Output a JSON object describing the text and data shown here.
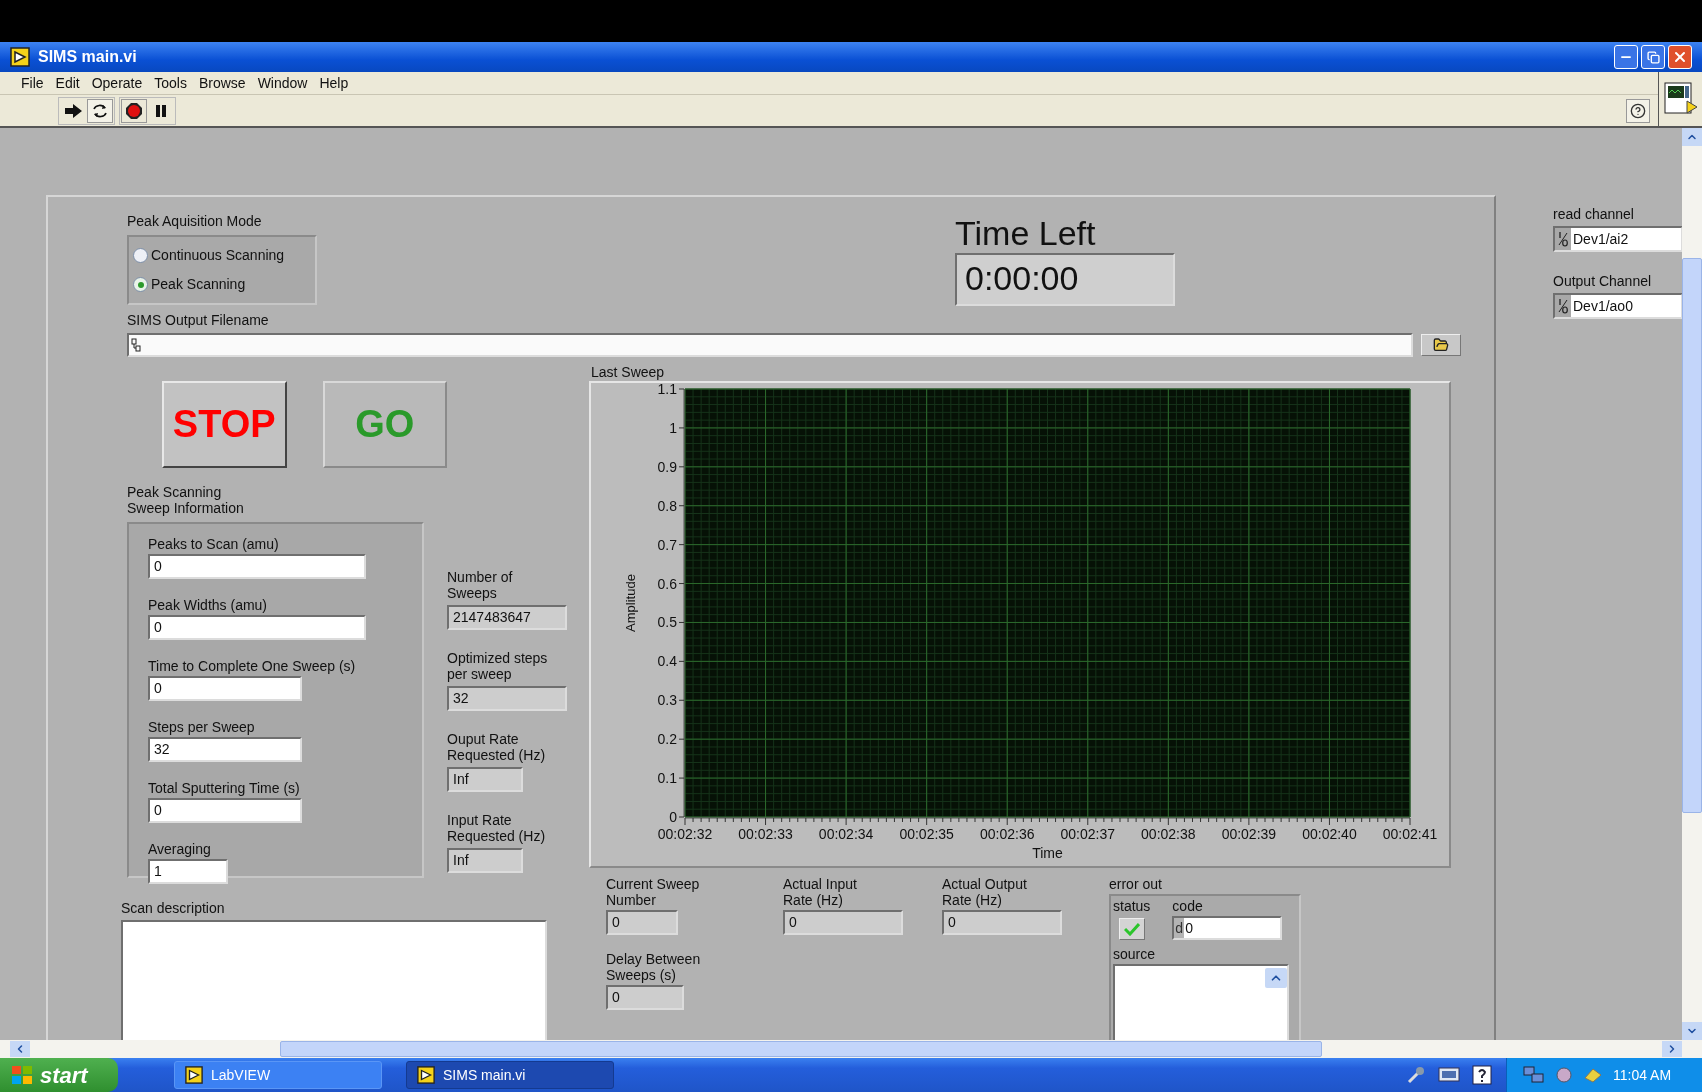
{
  "window": {
    "title": "SIMS main.vi",
    "menu": [
      "File",
      "Edit",
      "Operate",
      "Tools",
      "Browse",
      "Window",
      "Help"
    ]
  },
  "acquisition_mode": {
    "label": "Peak Aquisition Mode",
    "options": [
      {
        "label": "Continuous Scanning",
        "selected": false
      },
      {
        "label": "Peak Scanning",
        "selected": true
      }
    ]
  },
  "time_left": {
    "label": "Time Left",
    "value": "0:00:00"
  },
  "output_filename": {
    "label": "SIMS Output Filename"
  },
  "buttons": [
    {
      "label": "STOP",
      "kind": "stop"
    },
    {
      "label": "GO",
      "kind": "go"
    }
  ],
  "sweep_info": {
    "title": "Peak Scanning\nSweep Information",
    "fields": [
      {
        "label": "Peaks to Scan (amu)",
        "value": "0"
      },
      {
        "label": "Peak Widths (amu)",
        "value": "0"
      },
      {
        "label": "Time to Complete One Sweep (s)",
        "value": "0"
      },
      {
        "label": "Steps per Sweep",
        "value": "32"
      },
      {
        "label": "Total Sputtering Time (s)",
        "value": "0"
      },
      {
        "label": "Averaging",
        "value": "1"
      }
    ]
  },
  "indicators": [
    {
      "label": "Number of\nSweeps",
      "value": "2147483647"
    },
    {
      "label": "Optimized steps\nper sweep",
      "value": "32"
    },
    {
      "label": "Ouput Rate\nRequested (Hz)",
      "value": "Inf"
    },
    {
      "label": "Input Rate\nRequested (Hz)",
      "value": "Inf"
    }
  ],
  "graph": {
    "chart_data": {
      "type": "line",
      "title": "Last Sweep",
      "xlabel": "Time",
      "ylabel": "Amplitude",
      "ylim": [
        0,
        1.1
      ],
      "grid": true,
      "categories": [
        "00:02:32",
        "00:02:33",
        "00:02:34",
        "00:02:35",
        "00:02:36",
        "00:02:37",
        "00:02:38",
        "00:02:39",
        "00:02:40",
        "00:02:41"
      ],
      "yticks": [
        0,
        0.1,
        0.2,
        0.3,
        0.4,
        0.5,
        0.6,
        0.7,
        0.8,
        0.9,
        1,
        1.1
      ]
    }
  },
  "scan_description": {
    "label": "Scan description"
  },
  "status_indicators": [
    {
      "label": "Current Sweep\nNumber",
      "value": "0"
    },
    {
      "label": "Delay Between\nSweeps (s)",
      "value": "0"
    },
    {
      "label": "Actual Input\nRate (Hz)",
      "value": "0"
    },
    {
      "label": "Actual Output\nRate (Hz)",
      "value": "0"
    }
  ],
  "error_out": {
    "label": "error out",
    "status_label": "status",
    "status_ok": true,
    "code_label": "code",
    "code_prefix": "d",
    "code_value": "0",
    "source_label": "source"
  },
  "channels": [
    {
      "label": "read channel",
      "value": "Dev1/ai2"
    },
    {
      "label": "Output Channel",
      "value": "Dev1/ao0"
    }
  ],
  "taskbar": {
    "start": "start",
    "tasks": [
      {
        "label": "LabVIEW",
        "selected": false
      },
      {
        "label": "SIMS main.vi",
        "selected": true
      }
    ],
    "clock": "11:04 AM"
  }
}
